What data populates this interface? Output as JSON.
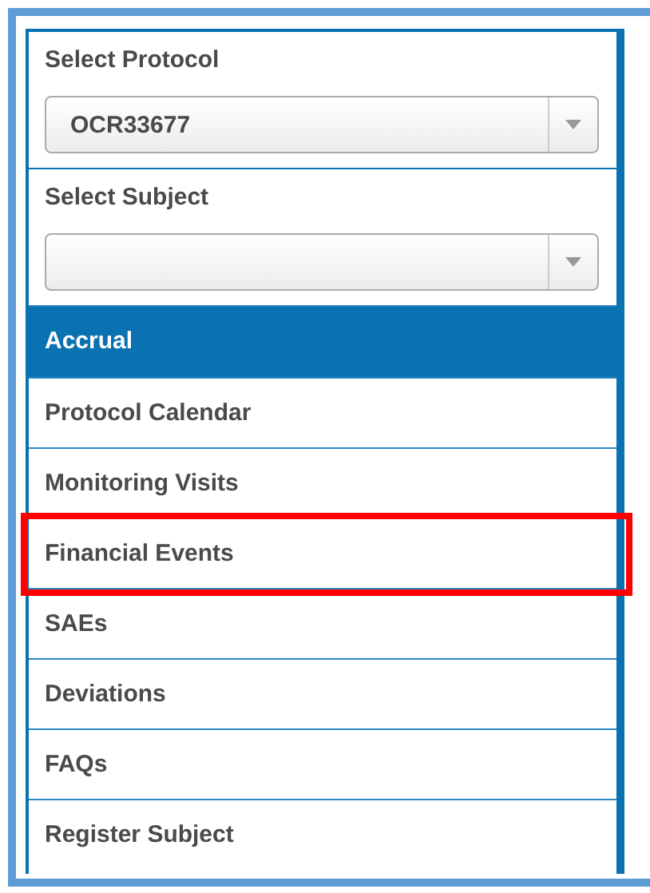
{
  "selects": [
    {
      "label": "Select Protocol",
      "value": "OCR33677"
    },
    {
      "label": "Select Subject"
    }
  ],
  "menu": [
    {
      "label": "Accrual",
      "selected": true,
      "highlighted": false
    },
    {
      "label": "Protocol Calendar",
      "selected": false,
      "highlighted": false
    },
    {
      "label": "Monitoring Visits",
      "selected": false,
      "highlighted": false
    },
    {
      "label": "Financial Events",
      "selected": false,
      "highlighted": true
    },
    {
      "label": "SAEs",
      "selected": false,
      "highlighted": false
    },
    {
      "label": "Deviations",
      "selected": false,
      "highlighted": false
    },
    {
      "label": "FAQs",
      "selected": false,
      "highlighted": false
    },
    {
      "label": "Register Subject",
      "selected": false,
      "highlighted": false
    }
  ]
}
